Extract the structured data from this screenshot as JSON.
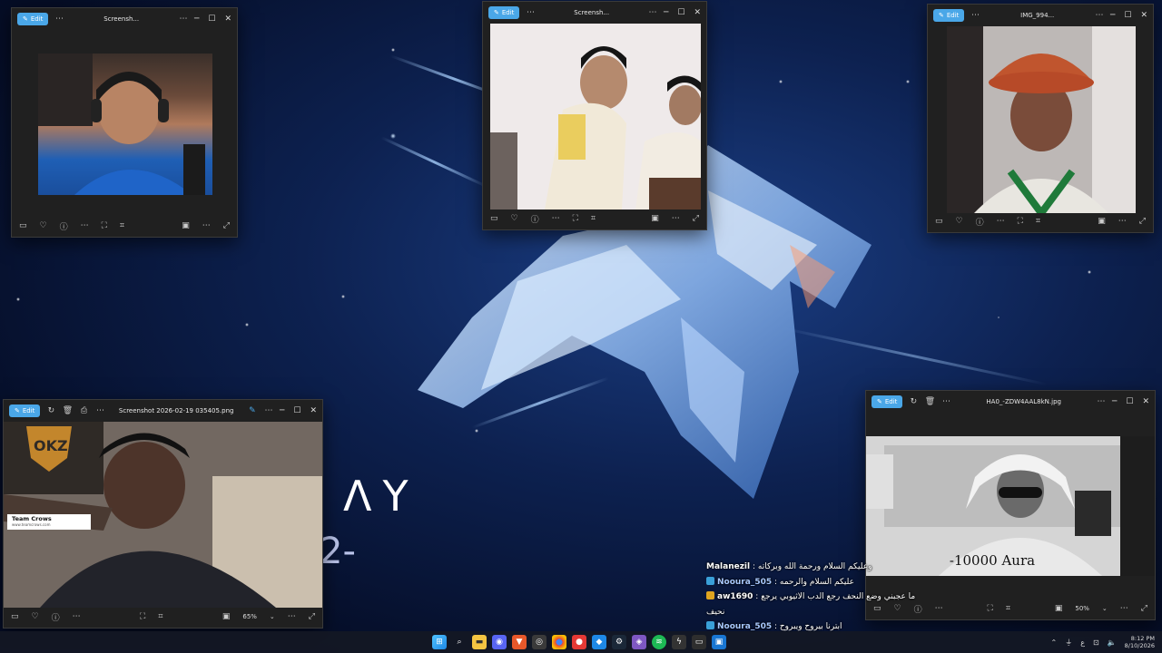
{
  "wallpaper": {
    "text_line1": "ΛY",
    "text_line2": "2-"
  },
  "windows": [
    {
      "id": "w1",
      "edit_label": "Edit",
      "title": "Screensh...",
      "zoom": ""
    },
    {
      "id": "w2",
      "edit_label": "Edit",
      "title": "Screensh...",
      "zoom": ""
    },
    {
      "id": "w3",
      "edit_label": "Edit",
      "title": "IMG_994...",
      "zoom": ""
    },
    {
      "id": "w4",
      "edit_label": "Edit",
      "title": "Screenshot 2026-02-19 035405.png",
      "zoom": "65%",
      "overlay_name": "Team Crows",
      "overlay_sub": "www.teamcrows.com"
    },
    {
      "id": "w5",
      "edit_label": "Edit",
      "title": "HA0_-ZDW4AAL8kN.jpg",
      "zoom": "50%",
      "caption": "-10000 Aura"
    }
  ],
  "chat": [
    {
      "user": "Malanezil",
      "sep": " : ",
      "message": "وعليكم السلام ورحمة الله وبركاته",
      "badge_color": "",
      "user_color": "white"
    },
    {
      "user": "Nooura_505",
      "sep": " : ",
      "message": "عليكم السلام والرحمه",
      "badge_color": "#3aa0d8",
      "user_color": "blue"
    },
    {
      "user": "aw1690",
      "sep": " : ",
      "message": "ما عجبني وضع النحف رجع الدب الاثيوبي يرجع",
      "badge_color": "#e0a520",
      "user_color": "white"
    },
    {
      "user": "",
      "sep": "",
      "message": "نحيف",
      "badge_color": "",
      "user_color": "white"
    },
    {
      "user": "Nooura_505",
      "sep": " : ",
      "message": "ابترنا بيروح ويبروح",
      "badge_color": "#3aa0d8",
      "user_color": "blue"
    }
  ],
  "taskbar": {
    "time": "8:12 PM",
    "date": "8/10/2026",
    "lang": "ع"
  },
  "colors": {
    "accent": "#4aa7e8",
    "window_bg": "#202020",
    "wallpaper": "#0d2150"
  }
}
